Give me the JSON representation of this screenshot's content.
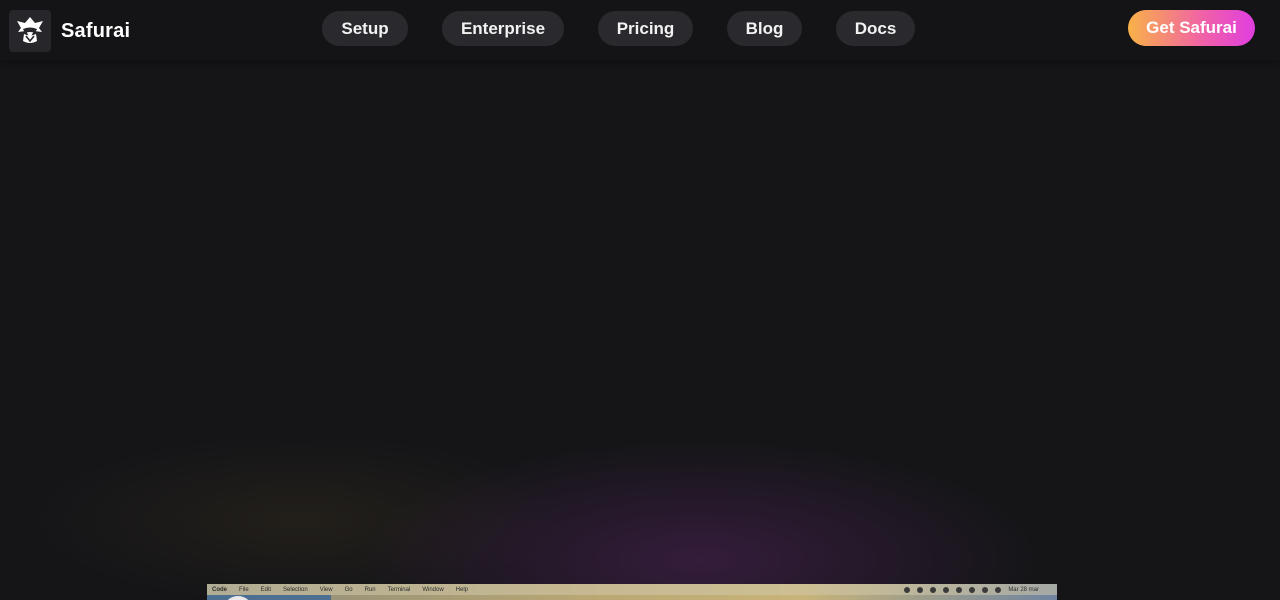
{
  "brand": {
    "name": "Safurai",
    "logo_icon": "samurai-helmet-icon"
  },
  "nav": {
    "items": [
      {
        "label": "Setup"
      },
      {
        "label": "Enterprise"
      },
      {
        "label": "Pricing"
      },
      {
        "label": "Blog"
      },
      {
        "label": "Docs"
      }
    ]
  },
  "cta": {
    "label": "Get Safurai",
    "gradient": [
      "#f9b247",
      "#f060a8",
      "#e03ee0"
    ]
  },
  "preview": {
    "menu": [
      "Code",
      "File",
      "Edit",
      "Selection",
      "View",
      "Go",
      "Run",
      "Terminal",
      "Window",
      "Help"
    ],
    "date": "Mar 28 mar"
  },
  "colors": {
    "background": "#151518",
    "header": "#141416",
    "pill": "#2a2a2e"
  }
}
